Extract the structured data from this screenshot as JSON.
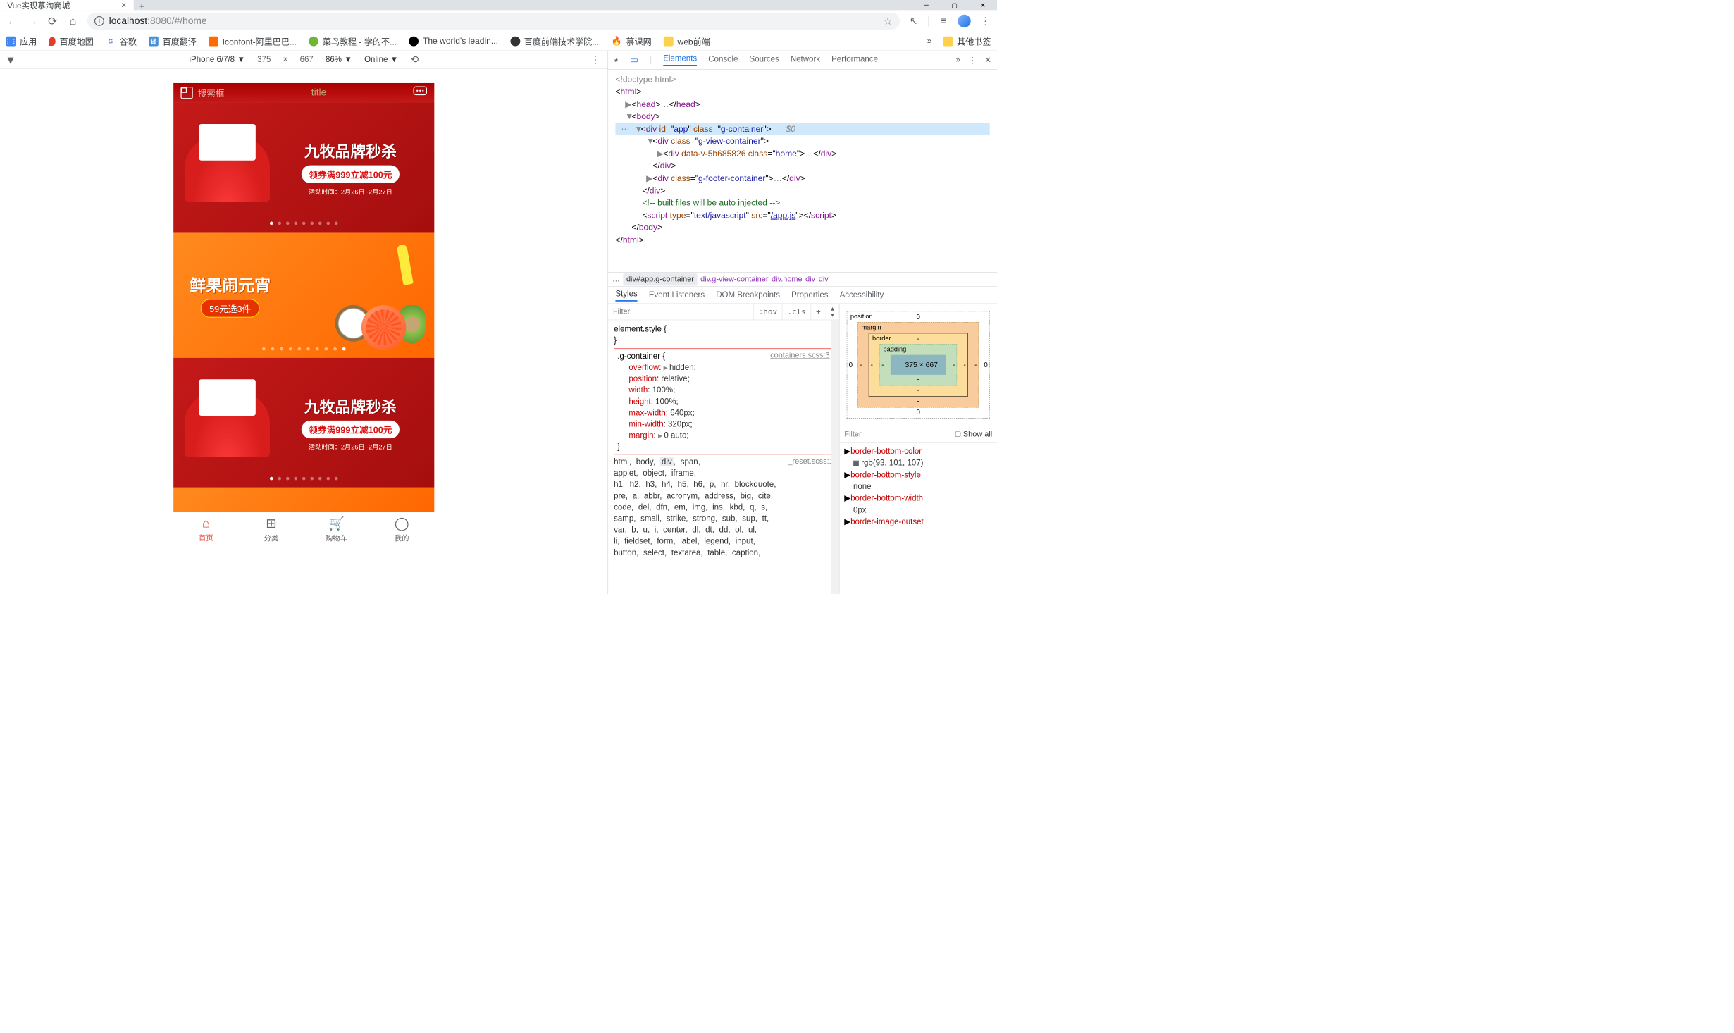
{
  "tab_strip": {
    "active_tab": "Vue实现慕淘商城"
  },
  "url": {
    "scheme_icon": "i",
    "host": "localhost",
    "port_path": ":8080/#/home"
  },
  "nav": {
    "back": "←",
    "fwd": "→",
    "reload": "⟳",
    "home": "⌂"
  },
  "ext": {
    "cursor": "↖",
    "reading": "≡",
    "dots": "⋮"
  },
  "bookmarks": {
    "lead": "应用",
    "items": [
      {
        "icon_bg": "#e33b2e",
        "icon_txt": "",
        "label": "百度地图"
      },
      {
        "icon_bg": "#fff",
        "icon_txt": "G",
        "label": "谷歌"
      },
      {
        "icon_bg": "#4a90d9",
        "icon_txt": "译",
        "label": "百度翻译"
      },
      {
        "icon_bg": "#ff6a00",
        "icon_txt": "",
        "label": "Iconfont-阿里巴巴..."
      },
      {
        "icon_bg": "#6fb536",
        "icon_txt": "",
        "label": "菜鸟教程 - 学的不..."
      },
      {
        "icon_bg": "#000",
        "icon_txt": "",
        "label": "The world's leadin..."
      },
      {
        "icon_bg": "#333",
        "icon_txt": "",
        "label": "百度前端技术学院..."
      },
      {
        "icon_bg": "#fff",
        "icon_txt": "🔥",
        "label": "慕课网"
      },
      {
        "icon_bg": "#ffd04c",
        "icon_txt": "",
        "label": "web前端"
      }
    ],
    "overflow": "»",
    "other": "其他书签"
  },
  "device_bar": {
    "device": "iPhone 6/7/8",
    "w": "375",
    "x": "×",
    "h": "667",
    "zoom": "86%",
    "net": "Online",
    "rotate": "⟲"
  },
  "phone": {
    "search_ph": "搜索框",
    "title": "title",
    "hero_h": "九牧品牌秒杀",
    "hero_pill": "领券满999立减100元",
    "hero_time": "活动时间：2月26日~2月27日",
    "fruit_h": "鲜果闹元宵",
    "fruit_pill": "59元选3件",
    "tabs": [
      "首页",
      "分类",
      "购物车",
      "我的"
    ]
  },
  "dt_tabs": {
    "elements": "Elements",
    "console": "Console",
    "sources": "Sources",
    "network": "Network",
    "performance": "Performance"
  },
  "dom": {
    "doctype": "<!doctype html>",
    "html_open": "html",
    "head_open": "head",
    "body_open": "body",
    "app_line": {
      "tag": "div",
      "id_k": "id",
      "id_v": "app",
      "class_k": "class",
      "class_v": "g-container",
      "after": " == $0"
    },
    "view_line": {
      "tag": "div",
      "class_k": "class",
      "class_v": "g-view-container"
    },
    "home_line": {
      "tag": "div",
      "data_k": "data-v-5b685826",
      "class_k": "class",
      "class_v": "home",
      "ellipsis": "…"
    },
    "footer_line": {
      "tag": "div",
      "class_k": "class",
      "class_v": "g-footer-container",
      "ellipsis": "…"
    },
    "comment": "<!-- built files will be auto injected -->",
    "script_line": {
      "tag": "script",
      "type_k": "type",
      "type_v": "text/javascript",
      "src_k": "src",
      "src_v": "/app.js"
    }
  },
  "crumbs": [
    "…",
    "div#app.g-container",
    "div.g-view-container",
    "div.home",
    "div",
    "div"
  ],
  "style_tabs": [
    "Styles",
    "Event Listeners",
    "DOM Breakpoints",
    "Properties",
    "Accessibility"
  ],
  "filter_ph": "Filter",
  "hov": ":hov",
  "cls": ".cls",
  "rule_el": {
    "sel": "element.style {",
    "close": "}"
  },
  "rule_gc": {
    "sel": ".g-container {",
    "src": "containers.scss:3",
    "props": [
      {
        "n": "overflow",
        "v": "hidden",
        "tw": true
      },
      {
        "n": "position",
        "v": "relative",
        "tw": false
      },
      {
        "n": "width",
        "v": "100%",
        "tw": false
      },
      {
        "n": "height",
        "v": "100%",
        "tw": false
      },
      {
        "n": "max-width",
        "v": "640px",
        "tw": false
      },
      {
        "n": "min-width",
        "v": "320px",
        "tw": false
      },
      {
        "n": "margin",
        "v": "0 auto",
        "tw": true
      }
    ],
    "close": "}"
  },
  "rule_reset": {
    "src": "_reset.scss:1",
    "lines": [
      "html, body, div, span,",
      "applet, object, iframe,",
      "h1, h2, h3, h4, h5, h6, p, hr, blockquote,",
      "pre, a, abbr, acronym, address, big, cite,",
      "code, del, dfn, em, img, ins, kbd, q, s,",
      "samp, small, strike, strong, sub, sup, tt,",
      "var, b, u, i, center, dl, dt, dd, ol, ul,",
      "li, fieldset, form, label, legend, input,",
      "button, select, textarea, table, caption,"
    ]
  },
  "box": {
    "pos": "position",
    "margin": "margin",
    "border": "border",
    "padding": "padding",
    "content": "375 × 667",
    "dash": "-",
    "zero": "0"
  },
  "comp_filter": "Filter",
  "comp_show_all": "Show all",
  "computed": [
    {
      "n": "border-bottom-color",
      "v": "rgb(93, 101, 107)",
      "swatch": true
    },
    {
      "n": "border-bottom-style",
      "v": "none"
    },
    {
      "n": "border-bottom-width",
      "v": "0px"
    },
    {
      "n": "border-image-outset",
      "v": ""
    }
  ]
}
